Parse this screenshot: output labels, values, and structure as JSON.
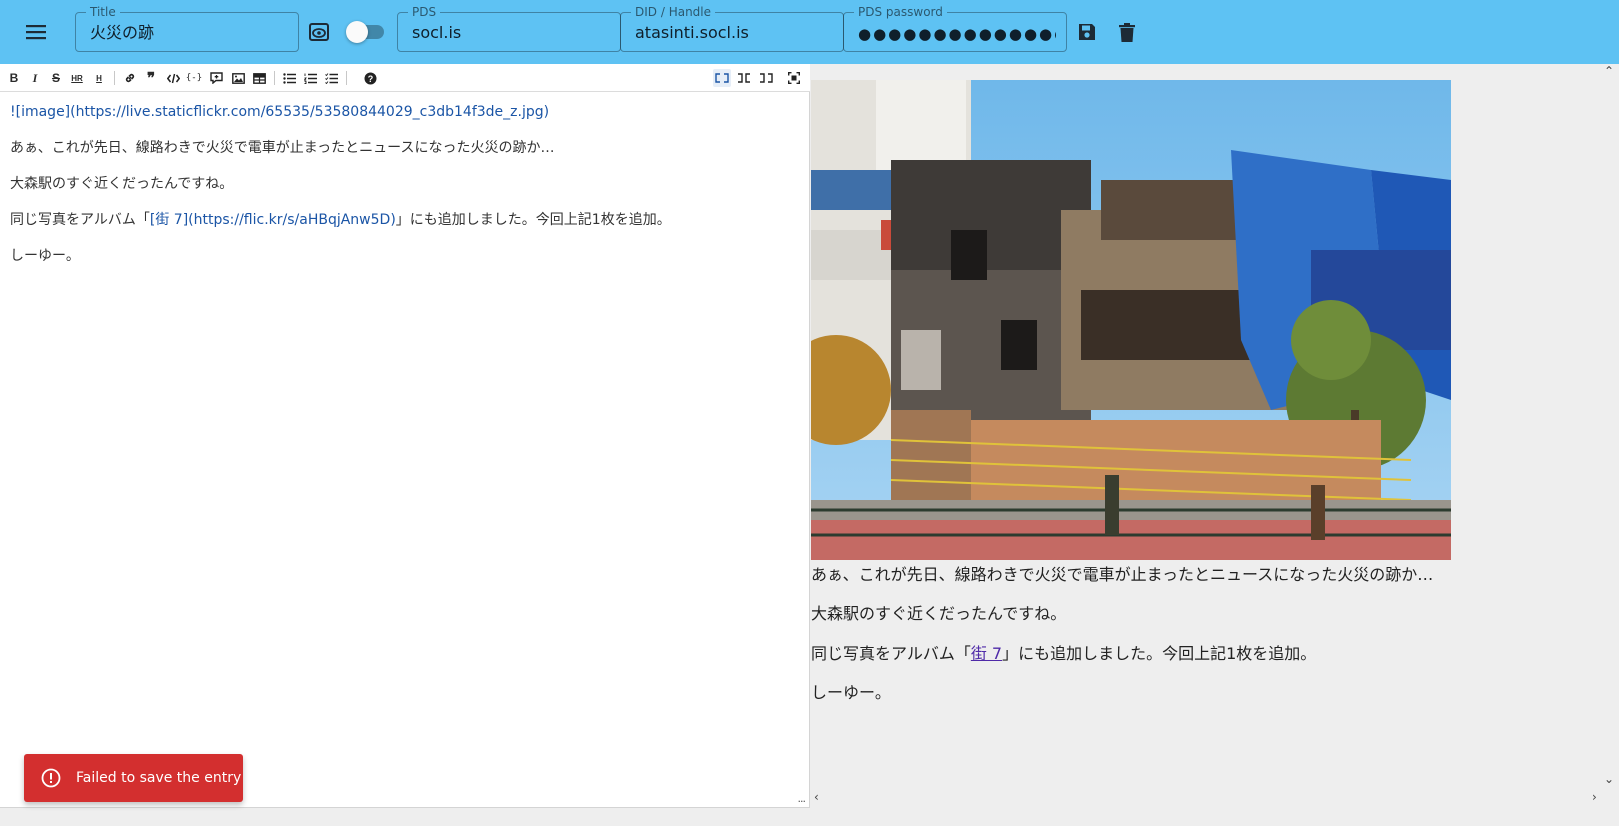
{
  "header": {
    "menu_icon": "menu-icon",
    "title_label": "Title",
    "title_value": "火災の跡",
    "preview_icon": "preview-icon",
    "toggle_on": false,
    "pds_label": "PDS",
    "pds_value": "socl.is",
    "handle_label": "DID / Handle",
    "handle_value": "atasinti.socl.is",
    "password_label": "PDS password",
    "password_value": "●●●●●●●●●●●●●●●●●●●●●",
    "save_icon": "save-icon",
    "delete_icon": "delete-icon",
    "bar_color": "#5ec2f3"
  },
  "toolbar": {
    "tools": [
      "bold",
      "italic",
      "strikethrough",
      "heading-2",
      "heading",
      "link",
      "quote",
      "code",
      "code-block",
      "comment",
      "image",
      "table",
      "unordered-list",
      "ordered-list",
      "task-list",
      "help"
    ],
    "modes": [
      "editor-only",
      "side-by-side",
      "preview-only",
      "fullscreen"
    ],
    "active_mode": "editor-only"
  },
  "editor": {
    "line1": "![image](https://live.staticflickr.com/65535/53580844029_c3db14f3de_z.jpg)",
    "line2": "あぁ、これが先日、線路わきで火災で電車が止まったとニュースになった火災の跡か…",
    "line3": "大森駅のすぐ近くだったんですね。",
    "line4_pre": "同じ写真をアルバム「",
    "line4_link": "[街 7](https://flic.kr/s/aHBqjAnw5D)",
    "line4_post": "」にも追加しました。今回上記1枚を追加。",
    "line5": "しーゆー。",
    "resize_handle": "..."
  },
  "preview": {
    "line1": "あぁ、これが先日、線路わきで火災で電車が止まったとニュースになった火災の跡か…",
    "line2": "大森駅のすぐ近くだったんですね。",
    "line3_pre": "同じ写真をアルバム「",
    "line3_link": "街 7",
    "line3_post": "」にも追加しました。今回上記1枚を追加。",
    "line4": "しーゆー。"
  },
  "snackbar": {
    "icon": "error-icon",
    "message": "Failed to save the entry",
    "color": "#d32f2f"
  }
}
